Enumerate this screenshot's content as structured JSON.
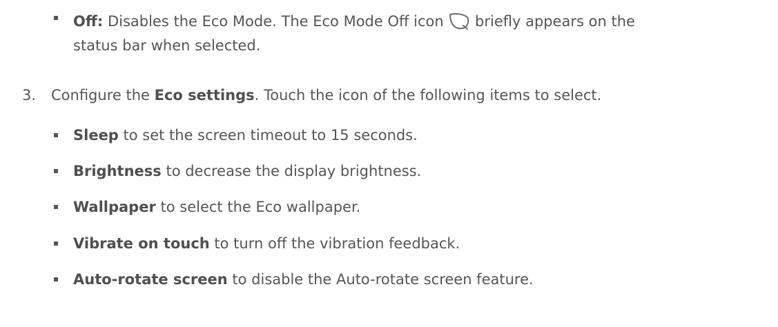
{
  "sections": {
    "off": {
      "term": "Off:",
      "text_before_icon": " Disables the Eco Mode. The Eco Mode Off icon ",
      "text_after_icon": " briefly appears on the",
      "continuation": "status bar when selected.",
      "icon": "leaf-outline-icon"
    },
    "step3": {
      "number": "3.",
      "text_before": "Configure the ",
      "term": "Eco settings",
      "text_after": ". Touch the icon of the following items to select."
    },
    "items": [
      {
        "term": "Sleep",
        "text": " to set the screen timeout to 15 seconds."
      },
      {
        "term": "Brightness",
        "text": " to decrease the display brightness."
      },
      {
        "term": "Wallpaper",
        "text": " to select the Eco wallpaper."
      },
      {
        "term": "Vibrate on touch",
        "text": " to turn off the vibration feedback."
      },
      {
        "term": "Auto-rotate screen",
        "text": " to disable the Auto-rotate screen feature."
      }
    ]
  }
}
